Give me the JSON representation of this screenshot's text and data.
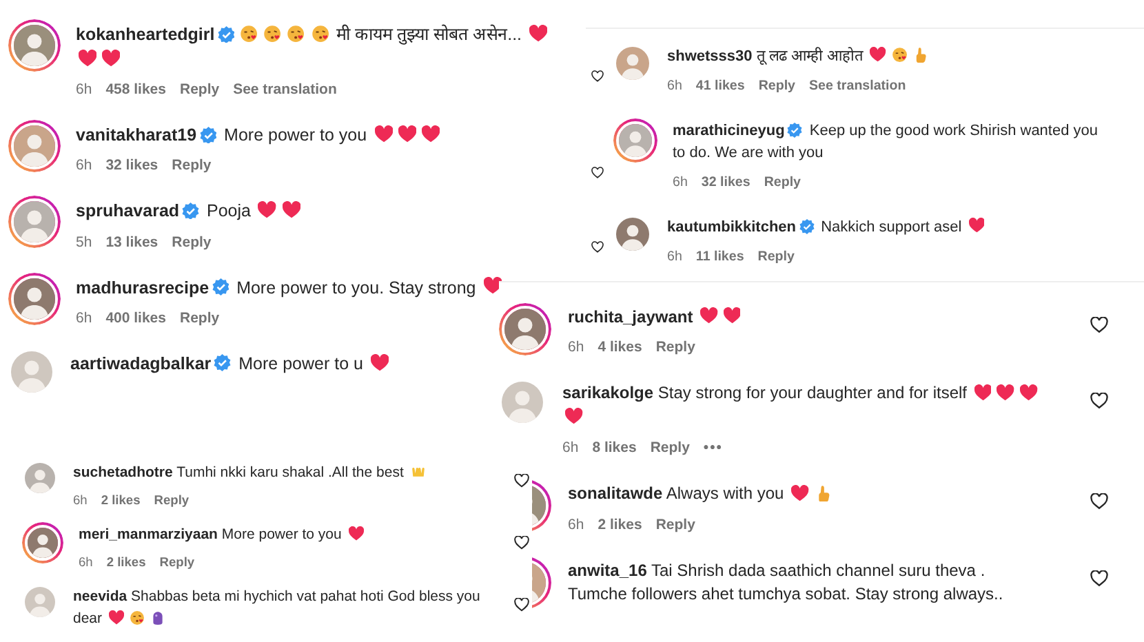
{
  "panels": [
    {
      "comments": [
        {
          "username": "kokanheartedgirl",
          "verified": true,
          "story_ring": true,
          "parts": [
            {
              "kind": "kiss"
            },
            {
              "kind": "kiss"
            },
            {
              "kind": "kiss"
            },
            {
              "kind": "kiss"
            },
            {
              "kind": "text",
              "text": "मी कायम तुझ्या सोबत असेन..."
            },
            {
              "kind": "heart"
            },
            {
              "kind": "heart"
            },
            {
              "kind": "heart"
            }
          ],
          "meta": {
            "time": "6h",
            "likes": "458 likes",
            "reply": "Reply",
            "translation": "See translation"
          }
        },
        {
          "username": "vanitakharat19",
          "verified": true,
          "story_ring": true,
          "parts": [
            {
              "kind": "text",
              "text": "More power to you"
            },
            {
              "kind": "heart"
            },
            {
              "kind": "heart"
            },
            {
              "kind": "heart"
            }
          ],
          "meta": {
            "time": "6h",
            "likes": "32 likes",
            "reply": "Reply"
          }
        },
        {
          "username": "spruhavarad",
          "verified": true,
          "story_ring": true,
          "parts": [
            {
              "kind": "text",
              "text": "Pooja"
            },
            {
              "kind": "heart"
            },
            {
              "kind": "heart"
            }
          ],
          "meta": {
            "time": "5h",
            "likes": "13 likes",
            "reply": "Reply"
          }
        },
        {
          "username": "madhurasrecipe",
          "verified": true,
          "story_ring": true,
          "parts": [
            {
              "kind": "text",
              "text": "More power to you. Stay strong"
            },
            {
              "kind": "heart"
            }
          ],
          "meta": {
            "time": "6h",
            "likes": "400 likes",
            "reply": "Reply"
          }
        },
        {
          "username": "aartiwadagbalkar",
          "verified": true,
          "story_ring": false,
          "parts": [
            {
              "kind": "text",
              "text": "More power to u"
            },
            {
              "kind": "heart"
            }
          ]
        }
      ]
    },
    {
      "comments": [
        {
          "username": "shwetsss30",
          "verified": false,
          "story_ring": false,
          "liked": false,
          "parts": [
            {
              "kind": "text",
              "text": "तू लढ आम्ही आहोत"
            },
            {
              "kind": "heart"
            },
            {
              "kind": "kiss"
            },
            {
              "kind": "hand"
            }
          ],
          "meta": {
            "time": "6h",
            "likes": "41 likes",
            "reply": "Reply",
            "translation": "See translation"
          }
        },
        {
          "username": "marathicineyug",
          "verified": true,
          "story_ring": true,
          "liked": false,
          "parts": [
            {
              "kind": "text",
              "text": "Keep up the good work Shirish wanted you"
            },
            {
              "kind": "text",
              "text": "to do. We are with you"
            }
          ],
          "meta": {
            "time": "6h",
            "likes": "32 likes",
            "reply": "Reply"
          }
        },
        {
          "username": "kautumbikkitchen",
          "verified": true,
          "story_ring": false,
          "liked": false,
          "parts": [
            {
              "kind": "text",
              "text": "Nakkich support asel"
            },
            {
              "kind": "heart"
            }
          ],
          "meta": {
            "time": "6h",
            "likes": "11 likes",
            "reply": "Reply"
          }
        }
      ]
    },
    {
      "comments": [
        {
          "username": "suchetadhotre",
          "verified": false,
          "story_ring": false,
          "liked": false,
          "parts": [
            {
              "kind": "text",
              "text": "Tumhi nkki karu shakal .All the best"
            },
            {
              "kind": "raised-hands"
            }
          ],
          "meta": {
            "time": "6h",
            "likes": "2 likes",
            "reply": "Reply"
          }
        },
        {
          "username": "meri_manmarziyaan",
          "verified": false,
          "story_ring": true,
          "liked": false,
          "parts": [
            {
              "kind": "text",
              "text": "More power to you"
            },
            {
              "kind": "heart"
            }
          ],
          "meta": {
            "time": "6h",
            "likes": "2 likes",
            "reply": "Reply"
          }
        },
        {
          "username": "neevida",
          "verified": false,
          "story_ring": false,
          "liked": false,
          "parts": [
            {
              "kind": "text",
              "text": "Shabbas beta mi hychich vat pahat hoti God bless you"
            },
            {
              "kind": "text",
              "text": "dear"
            },
            {
              "kind": "heart"
            },
            {
              "kind": "kiss"
            },
            {
              "kind": "other"
            }
          ]
        }
      ]
    },
    {
      "comments": [
        {
          "username": "ruchita_jaywant",
          "verified": false,
          "story_ring": true,
          "liked": false,
          "parts": [
            {
              "kind": "heart"
            },
            {
              "kind": "heart"
            }
          ],
          "meta": {
            "time": "6h",
            "likes": "4 likes",
            "reply": "Reply"
          }
        },
        {
          "username": "sarikakolge",
          "verified": false,
          "story_ring": false,
          "liked": false,
          "parts": [
            {
              "kind": "text",
              "text": "Stay strong for your daughter and for itself"
            },
            {
              "kind": "heart"
            },
            {
              "kind": "heart"
            },
            {
              "kind": "heart"
            },
            {
              "kind": "heart"
            }
          ],
          "meta": {
            "time": "6h",
            "likes": "8 likes",
            "reply": "Reply",
            "more": "•••"
          }
        },
        {
          "username": "sonalitawde",
          "verified": false,
          "story_ring": true,
          "liked": false,
          "parts": [
            {
              "kind": "text",
              "text": "Always with you"
            },
            {
              "kind": "heart"
            },
            {
              "kind": "hand"
            }
          ],
          "meta": {
            "time": "6h",
            "likes": "2 likes",
            "reply": "Reply"
          }
        },
        {
          "username": "anwita_16",
          "verified": false,
          "story_ring": true,
          "liked": false,
          "parts": [
            {
              "kind": "text",
              "text": "Tai Shrish dada saathich channel suru theva ."
            },
            {
              "kind": "text",
              "text": "Tumche followers ahet tumchya sobat. Stay strong always.."
            }
          ]
        }
      ]
    }
  ]
}
